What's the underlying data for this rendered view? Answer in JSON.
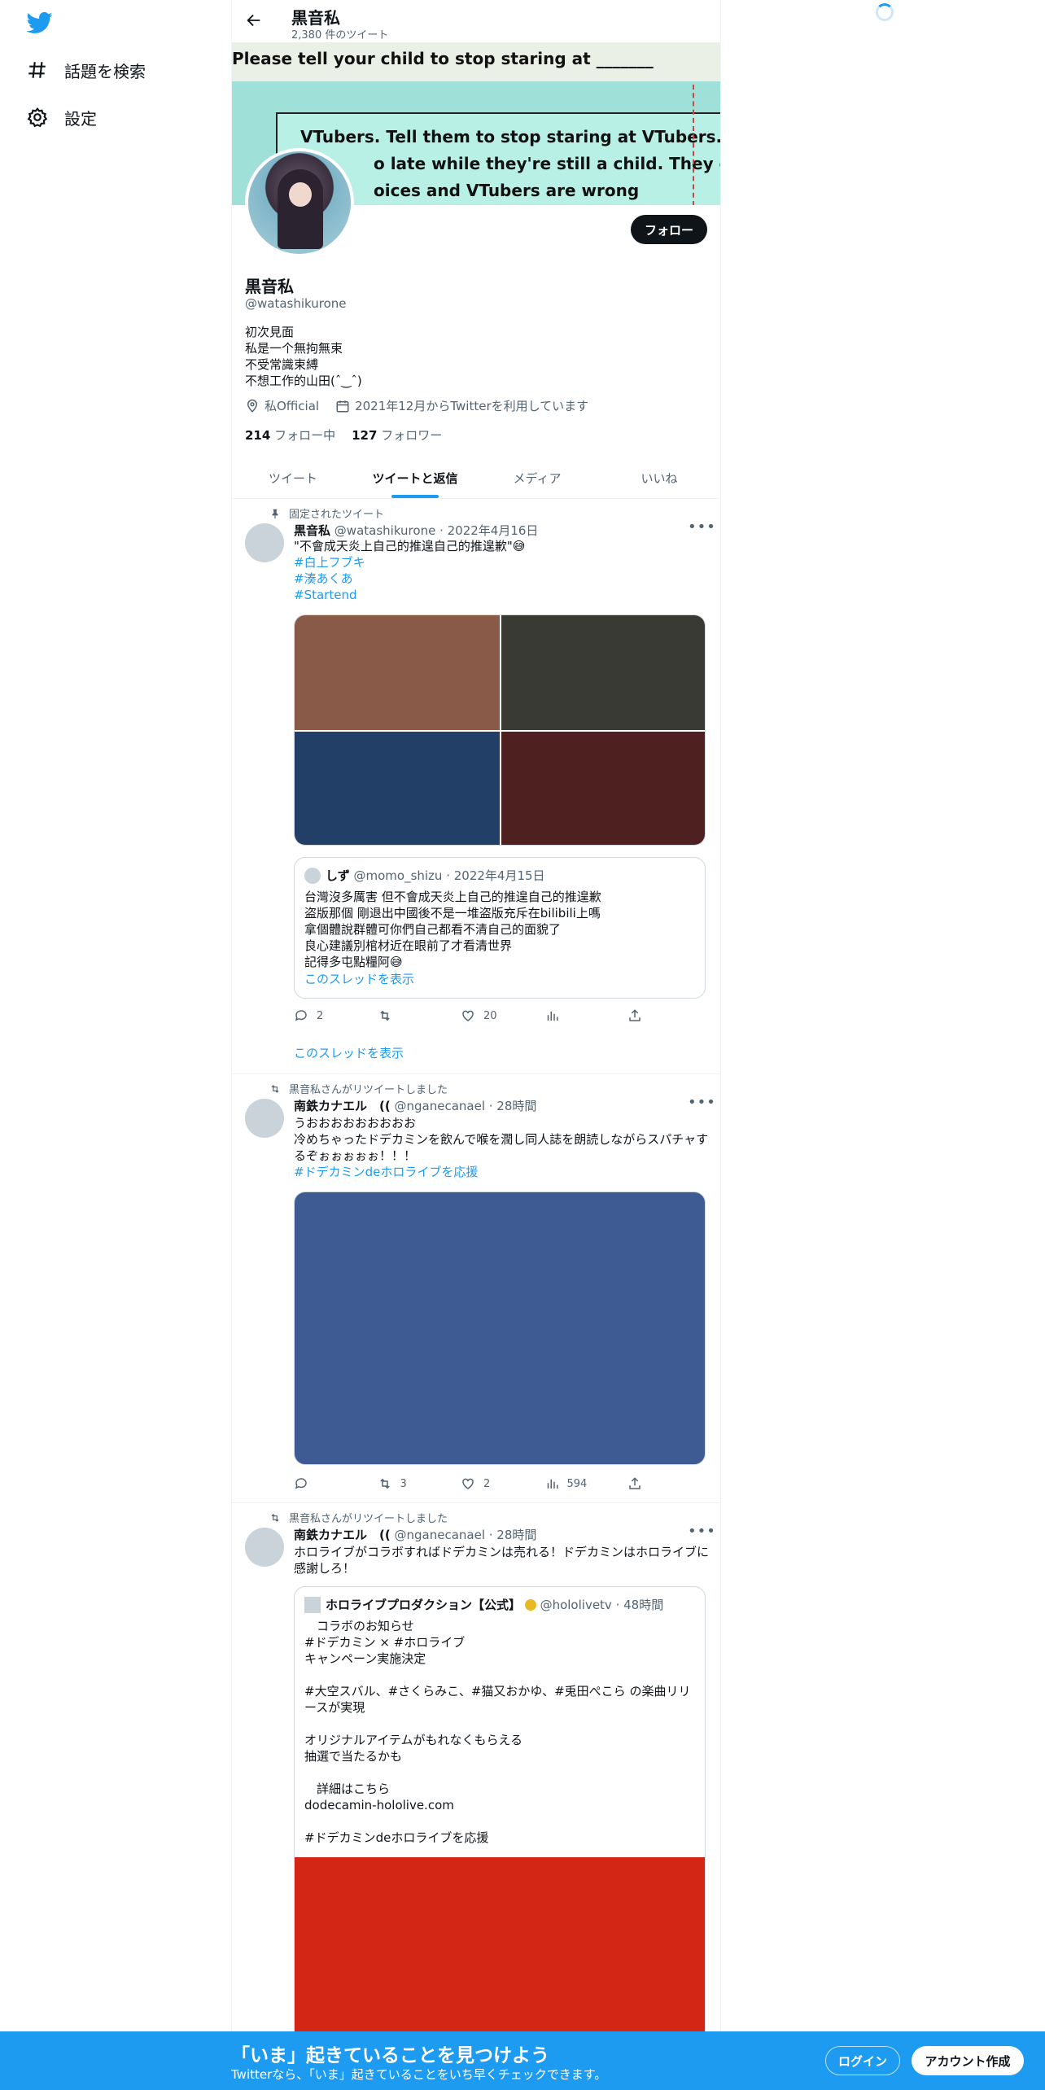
{
  "sidebar": {
    "items": [
      {
        "label": "話題を検索",
        "icon": "hashtag-icon"
      },
      {
        "label": "設定",
        "icon": "gear-icon"
      }
    ]
  },
  "header": {
    "title": "黒音私",
    "tweet_count": "2,380 件のツイート"
  },
  "banner": {
    "line1": "Please tell your child to stop staring at _______",
    "line2": "VTubers. Tell them to stop staring at VTubers. Please, it",
    "line3": "o late while they're still a child. They can make",
    "line4": "oices and VTubers are wrong"
  },
  "profile": {
    "follow_label": "フォロー",
    "name": "黒音私",
    "handle": "@watashikurone",
    "bio": "初次見面\n私是一个無拘無束\n不受常識束縛\n不想工作的山田(ˆ‿ˆ)",
    "location": "私Official",
    "joined": "2021年12月からTwitterを利用しています",
    "following_count": "214",
    "following_label": "フォロー中",
    "followers_count": "127",
    "followers_label": "フォロワー"
  },
  "tabs": [
    {
      "label": "ツイート",
      "active": false
    },
    {
      "label": "ツイートと返信",
      "active": true
    },
    {
      "label": "メディア",
      "active": false
    },
    {
      "label": "いいね",
      "active": false
    }
  ],
  "tweets": [
    {
      "pre": "固定されたツイート",
      "name": "黒音私",
      "handle": "@watashikurone · 2022年4月16日",
      "text": "\"不會成天炎上自己的推遑自己的推遑歉\"😅",
      "hashtags": [
        "#白上フブキ",
        "#湊あくあ",
        "#Startend"
      ],
      "media_colors": [
        "#8a5a48",
        "#3a3a34",
        "#223f68",
        "#4e2020"
      ],
      "quote": {
        "name": "しず",
        "handle": "@momo_shizu · 2022年4月15日",
        "text": "台灣沒多厲害 但不會成天炎上自己的推遑自己的推遑歉\n盗版那個 剛退出中國後不是一堆盗版充斥在bilibili上嗎\n拿個體說群體可你們自己都看不清自己的面貌了\n良心建議別棺材近在眼前了才看清世界\n記得多屯點糧阿😅",
        "thread_link": "このスレッドを表示"
      },
      "replies": "2",
      "retweets": "",
      "likes": "20",
      "thread_link": "このスレッドを表示"
    },
    {
      "pre": "黒音私さんがリツイートしました",
      "name": "南鉄カナエル　((",
      "handle": "@nganecanael · 28時間",
      "text": "うおおおおおおおおお\n冷めちゃったドデカミンを飲んで喉を潤し同人誌を朗読しながらスパチャするぞぉぉぉぉぉ！！！",
      "hashtag": "#ドデカミンdeホロライブを応援",
      "media_color": "#3e5b93",
      "replies": "",
      "retweets": "3",
      "likes": "2",
      "views": "594"
    },
    {
      "pre": "黒音私さんがリツイートしました",
      "name": "南鉄カナエル　((",
      "handle": "@nganecanael · 28時間",
      "text": "ホロライブがコラボすればドデカミンは売れる！ドデカミンはホロライブに感謝しろ！",
      "quote": {
        "name": "ホロライブプロダクション【公式】",
        "handle": "@hololivetv · 48時間",
        "text": "　コラボのお知らせ\n#ドデカミン × #ホロライブ\nキャンペーン実施決定\n\n#大空スバル、#さくらみこ、#猫又おかゆ、#兎田ぺこら の楽曲リリースが実現\n\nオリジナルアイテムがもれなくもらえる\n抽選で当たるかも\n\n　詳細はこちら\ndodecamin-hololive.com\n\n#ドデカミンdeホロライブを応援",
        "media_color": "#d42614"
      }
    }
  ],
  "bottom_bar": {
    "title": "「いま」起きていることを見つけよう",
    "subtitle": "Twitterなら、「いま」起きていることをいち早くチェックできます。",
    "login": "ログイン",
    "signup": "アカウント作成"
  }
}
